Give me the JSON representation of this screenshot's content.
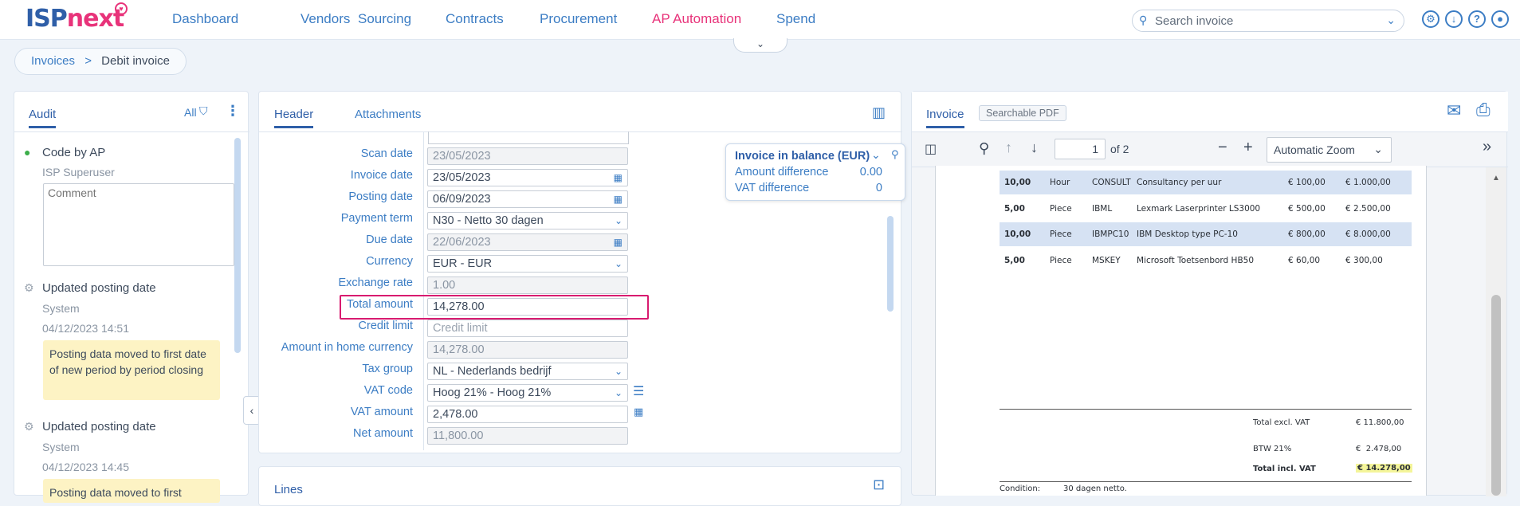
{
  "app": {
    "logo_main": "ISP",
    "logo_accent": "next"
  },
  "nav": [
    "Dashboard",
    "Vendors",
    "Sourcing",
    "Contracts",
    "Procurement",
    "AP Automation",
    "Spend"
  ],
  "nav_active_color": "#e8337a",
  "search": {
    "placeholder": "Search invoice"
  },
  "breadcrumb": {
    "parent": "Invoices",
    "sep": ">",
    "current": "Debit invoice"
  },
  "audit": {
    "tab": "Audit",
    "filter_label": "All",
    "items": [
      {
        "title": "Code by AP",
        "user": "ISP Superuser",
        "comment_placeholder": "Comment"
      },
      {
        "title": "Updated posting date",
        "user": "System",
        "time": "04/12/2023 14:51",
        "note": "Posting data moved to first date of new period by period closing"
      },
      {
        "title": "Updated posting date",
        "user": "System",
        "time": "04/12/2023 14:45",
        "note": "Posting data moved to first"
      }
    ]
  },
  "header_tabs": {
    "header": "Header",
    "attachments": "Attachments"
  },
  "form": {
    "scan_date": {
      "label": "Scan date",
      "value": "23/05/2023"
    },
    "invoice_date": {
      "label": "Invoice date",
      "value": "23/05/2023"
    },
    "posting_date": {
      "label": "Posting date",
      "value": "06/09/2023"
    },
    "payment_term": {
      "label": "Payment term",
      "value": "N30 - Netto 30 dagen"
    },
    "due_date": {
      "label": "Due date",
      "value": "22/06/2023"
    },
    "currency": {
      "label": "Currency",
      "value": "EUR - EUR"
    },
    "exchange_rate": {
      "label": "Exchange rate",
      "value": "1.00"
    },
    "total_amount": {
      "label": "Total amount",
      "value": "14,278.00"
    },
    "credit_limit": {
      "label": "Credit limit",
      "placeholder": "Credit limit"
    },
    "amount_home": {
      "label": "Amount in home currency",
      "value": "14,278.00"
    },
    "tax_group": {
      "label": "Tax group",
      "value": "NL - Nederlands bedrijf"
    },
    "vat_code": {
      "label": "VAT code",
      "value": "Hoog 21% - Hoog 21%"
    },
    "vat_amount": {
      "label": "VAT amount",
      "value": "2,478.00"
    },
    "net_amount": {
      "label": "Net amount",
      "value": "11,800.00"
    }
  },
  "balance": {
    "title": "Invoice in balance (EUR)",
    "amount_diff_label": "Amount difference",
    "amount_diff_value": "0.00",
    "vat_diff_label": "VAT difference",
    "vat_diff_value": "0"
  },
  "lines": {
    "title": "Lines"
  },
  "viewer": {
    "tab_invoice": "Invoice",
    "tab_pdf": "Searchable PDF",
    "page": "1",
    "page_of": "of 2",
    "zoom": "Automatic Zoom",
    "rows": [
      {
        "qty": "10,00",
        "unit": "Hour",
        "code": "CONSULT",
        "desc": "Consultancy per uur",
        "price": "€ 100,00",
        "total": "€ 1.000,00",
        "hl": true
      },
      {
        "qty": "5,00",
        "unit": "Piece",
        "code": "IBML",
        "desc": "Lexmark Laserprinter LS3000",
        "price": "€ 500,00",
        "total": "€ 2.500,00",
        "hl": false
      },
      {
        "qty": "10,00",
        "unit": "Piece",
        "code": "IBMPC10",
        "desc": "IBM Desktop type PC-10",
        "price": "€ 800,00",
        "total": "€ 8.000,00",
        "hl": true
      },
      {
        "qty": "5,00",
        "unit": "Piece",
        "code": "MSKEY",
        "desc": "Microsoft Toetsenbord HB50",
        "price": "€ 60,00",
        "total": "€ 300,00",
        "hl": false
      }
    ],
    "totals": [
      {
        "label": "Total excl. VAT",
        "value": "€ 11.800,00"
      },
      {
        "label": "BTW 21%",
        "value": "€  2.478,00"
      },
      {
        "label": "Total incl. VAT",
        "value": "€ 14.278,00"
      }
    ],
    "condition_label": "Condition:",
    "condition_value": "30 dagen netto."
  }
}
